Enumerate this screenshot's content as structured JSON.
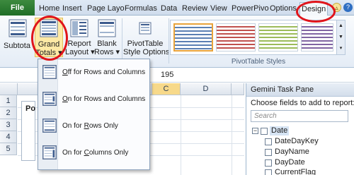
{
  "tabs": {
    "file": "File",
    "items": [
      "Home",
      "Insert",
      "Page Layo",
      "Formulas",
      "Data",
      "Review",
      "View",
      "PowerPivo",
      "Options",
      "Design"
    ],
    "active": "Design"
  },
  "ribbon": {
    "subtotals": "Subtota",
    "grand_totals_line1": "Grand",
    "grand_totals_line2": "Totals ▾",
    "report_layout_line1": "Report",
    "report_layout_line2": "Layout ▾",
    "blank_rows_line1": "Blank",
    "blank_rows_line2": "Rows ▾",
    "pivot_style_options_line1": "PivotTable",
    "pivot_style_options_line2": "Style Options ▾",
    "pivot_styles_group": "PivotTable Styles"
  },
  "formula_bar": {
    "value": "195"
  },
  "sheet": {
    "columns": [
      "C",
      "D"
    ],
    "rows": [
      "1",
      "2",
      "3",
      "4",
      "5"
    ],
    "cell_fragment": "Po"
  },
  "dropdown": {
    "items": [
      {
        "pre": "",
        "key": "O",
        "post": "ff for Rows and Columns"
      },
      {
        "pre": "",
        "key": "O",
        "post": "n for Rows and Columns"
      },
      {
        "pre": "On for ",
        "key": "R",
        "post": "ows Only"
      },
      {
        "pre": "On for ",
        "key": "C",
        "post": "olumns Only"
      }
    ]
  },
  "task_pane": {
    "title": "Gemini Task Pane",
    "subtitle": "Choose fields to add to report:",
    "search_placeholder": "Search",
    "table": "Date",
    "fields": [
      "DateDayKey",
      "DayName",
      "DayDate",
      "CurrentFlag"
    ]
  },
  "colors": {
    "file_tab": "#2a7a2e",
    "highlight": "#e0141b",
    "ribbon_bg": "#eef3f9"
  }
}
